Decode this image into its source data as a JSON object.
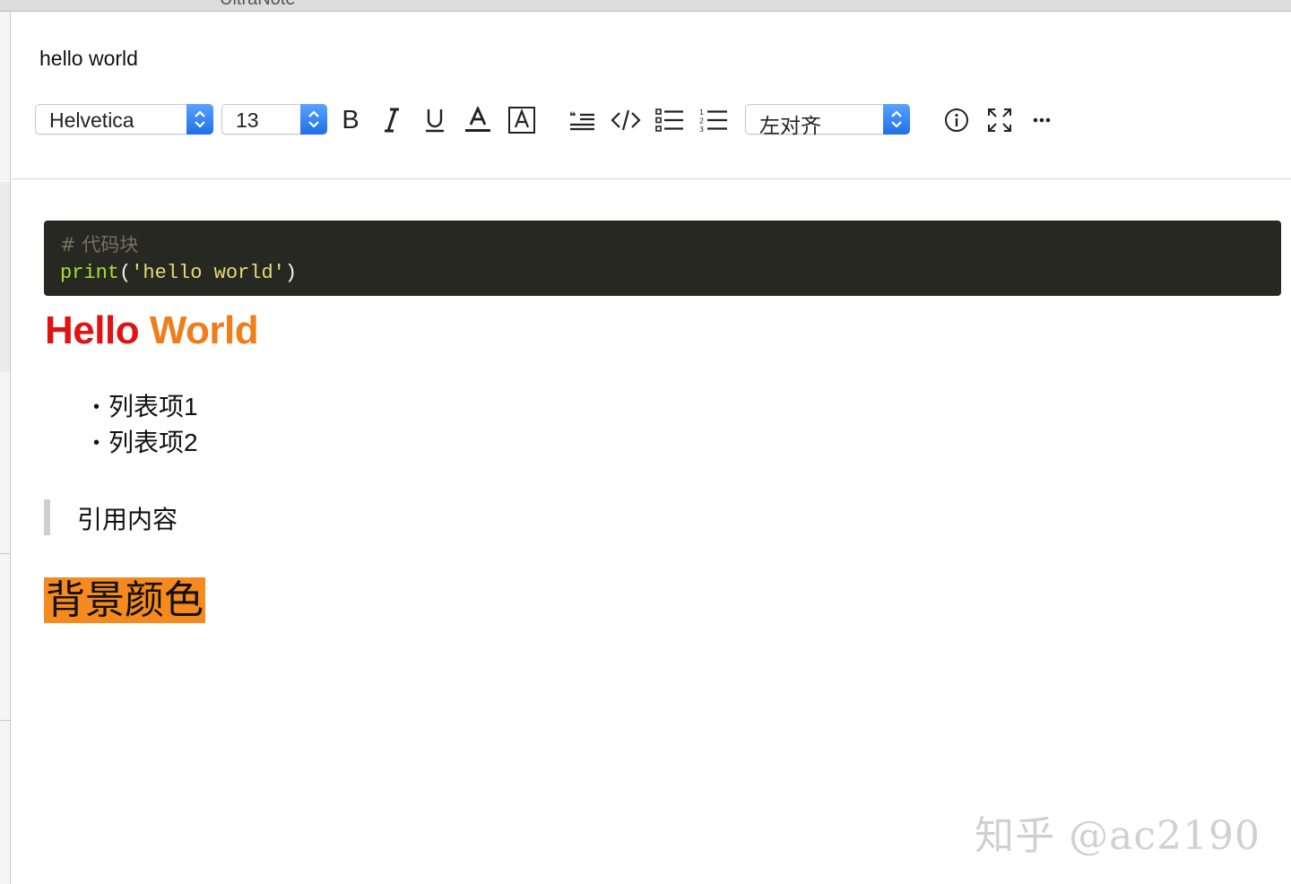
{
  "window": {
    "title": "UltraNote"
  },
  "note": {
    "title": "hello world"
  },
  "toolbar": {
    "font_family": "Helvetica",
    "font_size": "13",
    "alignment": "左对齐",
    "accent_color": "#2a7cf0",
    "buttons": [
      {
        "name": "bold-icon"
      },
      {
        "name": "italic-icon"
      },
      {
        "name": "underline-icon"
      },
      {
        "name": "text-color-icon"
      },
      {
        "name": "text-background-icon"
      },
      {
        "name": "blockquote-icon"
      },
      {
        "name": "code-icon"
      },
      {
        "name": "bullet-list-icon"
      },
      {
        "name": "numbered-list-icon"
      },
      {
        "name": "info-icon"
      },
      {
        "name": "fullscreen-icon"
      },
      {
        "name": "more-icon"
      }
    ]
  },
  "content": {
    "code": {
      "comment": "# 代码块",
      "fn": "print",
      "open": "(",
      "string": "'hello world'",
      "close": ")"
    },
    "heading": {
      "word1": "Hello",
      "word2": "World",
      "color1": "#e01212",
      "color2": "#f07d19"
    },
    "list": [
      "列表项1",
      "列表项2"
    ],
    "bullet": "•",
    "quote": "引用内容",
    "highlight": {
      "text": "背景颜色",
      "bg": "#f68a1e"
    }
  },
  "watermark": "知乎 @ac2190"
}
